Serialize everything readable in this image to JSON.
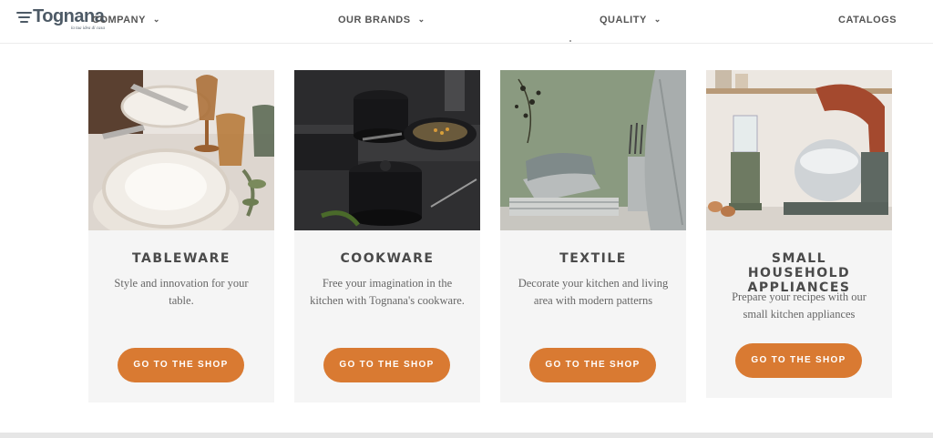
{
  "brand": {
    "logo_text": "Tognana",
    "tagline": "la tua idea di casa"
  },
  "nav": {
    "items": [
      {
        "label": "COMPANY",
        "has_dropdown": true
      },
      {
        "label": "OUR BRANDS",
        "has_dropdown": true
      },
      {
        "label": "QUALITY",
        "has_dropdown": true
      },
      {
        "label": "CATALOGS",
        "has_dropdown": false
      }
    ]
  },
  "cards": [
    {
      "title": "TABLEWARE",
      "description": "Style and innovation for your table.",
      "button_label": "GO TO THE SHOP",
      "image": "tableware-photo"
    },
    {
      "title": "COOKWARE",
      "description": "Free your imagination in the kitchen with Tognana's cookware.",
      "button_label": "GO TO THE SHOP",
      "image": "cookware-photo"
    },
    {
      "title": "TEXTILE",
      "description": "Decorate your kitchen and living area with modern patterns",
      "button_label": "GO TO THE SHOP",
      "image": "textile-photo"
    },
    {
      "title": "SMALL HOUSEHOLD APPLIANCES",
      "description": "Prepare your recipes with our small kitchen appliances",
      "button_label": "GO TO THE SHOP",
      "image": "appliances-photo"
    }
  ],
  "colors": {
    "accent": "#d97a32",
    "card_bg": "#f5f5f5",
    "logo": "#4d5a66"
  }
}
